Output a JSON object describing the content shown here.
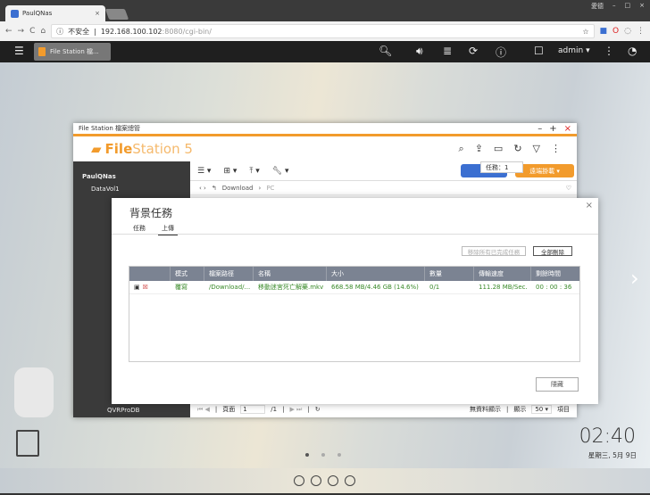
{
  "browser": {
    "tab_title": "PaulQNas",
    "user": "愛德",
    "insecure": "不安全",
    "url_host": "192.168.100.102",
    "url_rest": ":8080/cgi-bin/"
  },
  "qts": {
    "app_tab": "File Station 檔...",
    "user": "admin"
  },
  "filestation": {
    "window_title": "File Station 檔案總管",
    "brand_bold": "File",
    "brand_light": "Station 5",
    "tooltip": "任務：1",
    "remote_mount": "遠端掛載",
    "breadcrumb": [
      "Download",
      "PC"
    ],
    "tree": [
      "PaulQNas",
      "DataVol1",
      "QVRProDB"
    ],
    "footer": {
      "page_label": "頁面",
      "page": "1",
      "total": "/1",
      "no_data": "無資料顯示",
      "show": "顯示",
      "per_page": "50",
      "items": "項目"
    }
  },
  "dialog": {
    "title": "背景任務",
    "tabs": [
      "任務",
      "上傳"
    ],
    "remove_done": "移除所有已完成任務",
    "delete_all": "全部刪除",
    "columns": [
      "",
      "模式",
      "檔案路徑",
      "名稱",
      "大小",
      "數量",
      "傳輸速度",
      "剩餘時間"
    ],
    "rows": [
      {
        "mode": "覆寫",
        "path": "/Download/...",
        "name": "移動迷宮死亡解藥.mkv",
        "size": "668.58 MB/4.46 GB (14.6%)",
        "count": "0/1",
        "speed": "111.28 MB/Sec.",
        "remaining": "00 : 00 : 36"
      }
    ],
    "hide": "隱藏"
  },
  "desktop": {
    "time": "02:40",
    "date": "星期三, 5月 9日"
  }
}
